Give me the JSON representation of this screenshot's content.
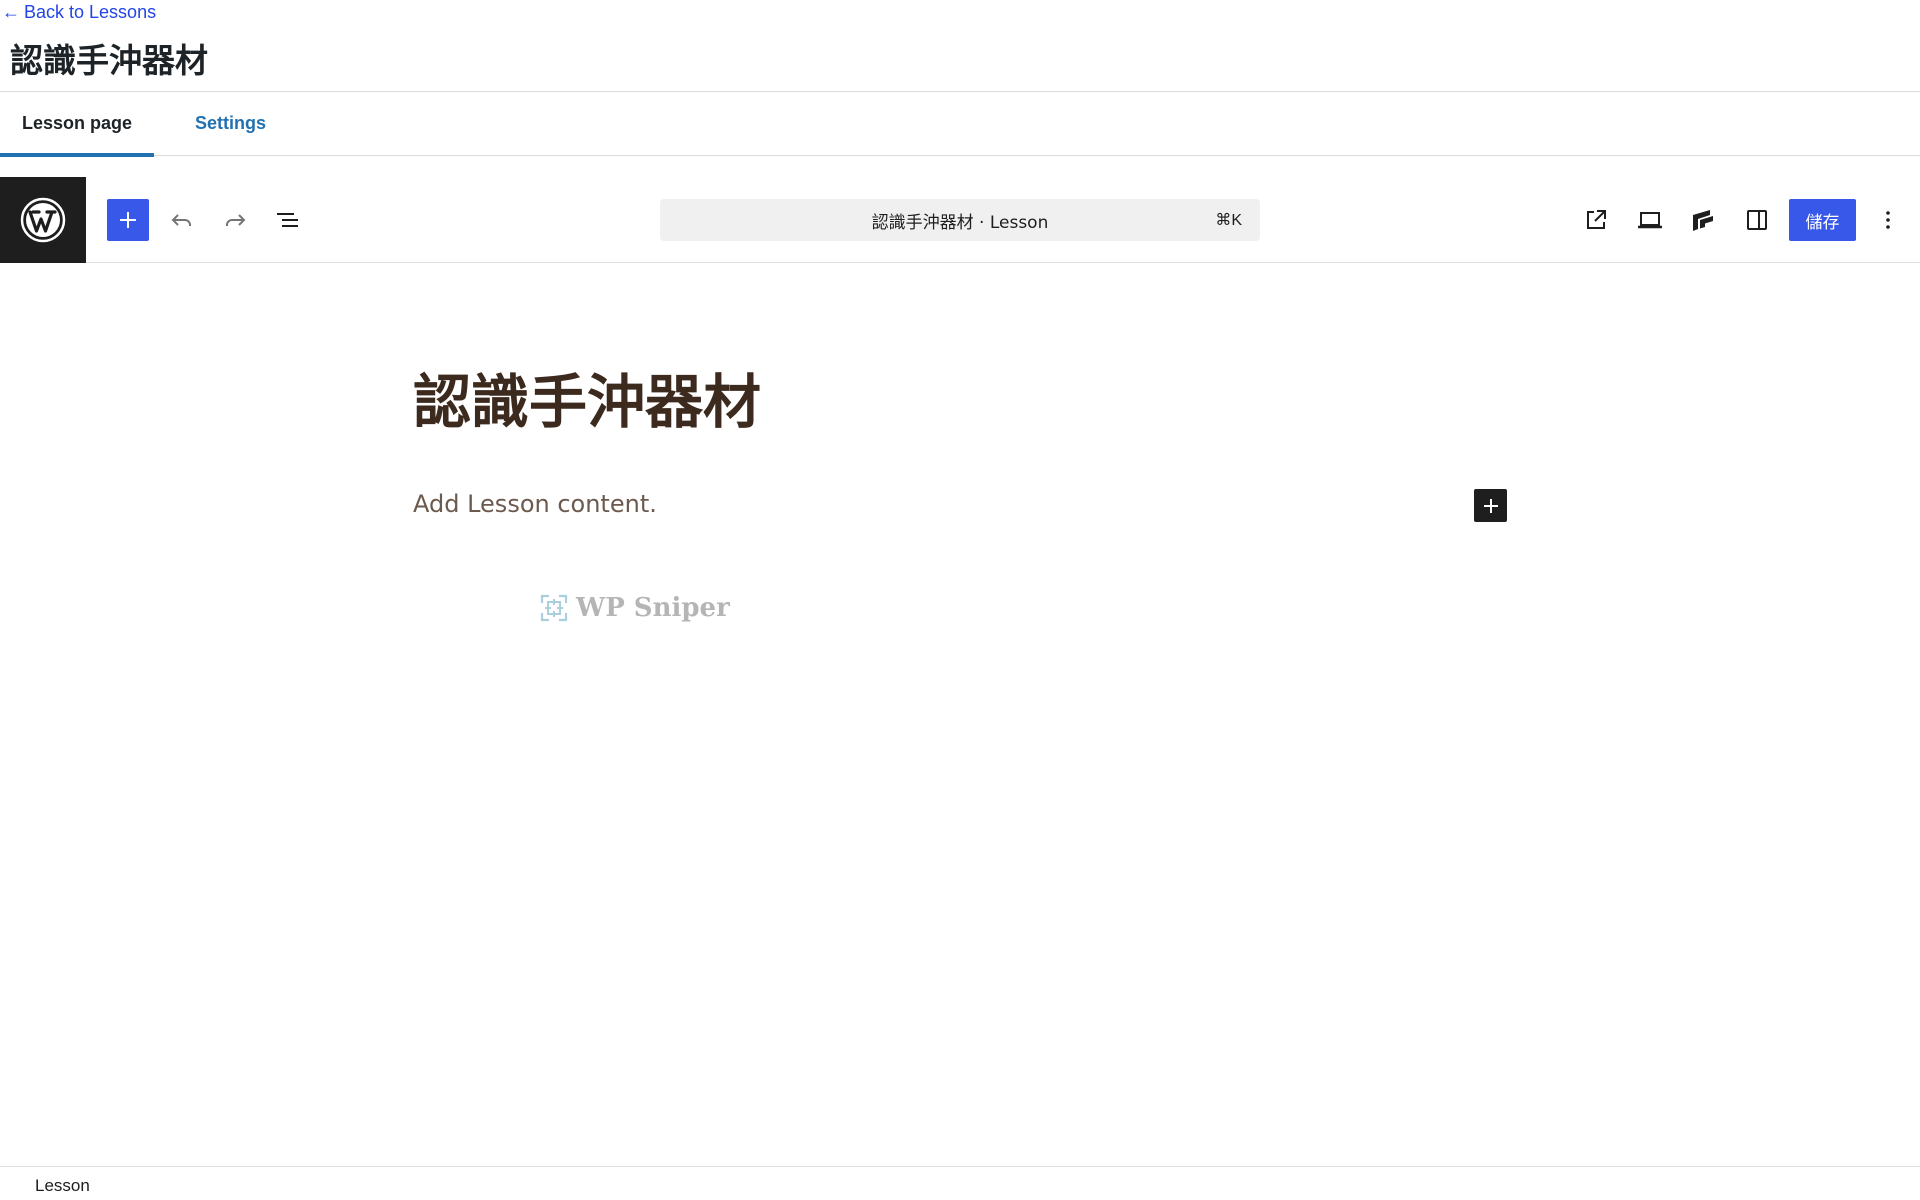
{
  "header": {
    "back_arrow": "←",
    "back_label": "Back to Lessons",
    "title": "認識手沖器材"
  },
  "tabs": [
    {
      "label": "Lesson page",
      "active": true
    },
    {
      "label": "Settings",
      "active": false
    }
  ],
  "toolbar": {
    "logo_icon": "wordpress-logo-icon",
    "add_icon": "plus-icon",
    "undo_icon": "undo-icon",
    "redo_icon": "redo-icon",
    "list_view_icon": "list-view-icon",
    "command_text": "認識手沖器材 · Lesson",
    "shortcut": "⌘K",
    "view_icon": "external-link-icon",
    "device_icon": "laptop-icon",
    "plugin_icon": "plugin-logo-icon",
    "sidebar_icon": "sidebar-toggle-icon",
    "save_label": "儲存",
    "more_icon": "more-vertical-icon"
  },
  "canvas": {
    "post_title": "認識手沖器材",
    "content_placeholder": "Add Lesson content.",
    "watermark": "WP Sniper"
  },
  "footer": {
    "breadcrumb": "Lesson"
  },
  "colors": {
    "accent": "#3858e9",
    "link": "#2271b1",
    "dark": "#1e1e1e",
    "title_brown": "#3d2a1f"
  }
}
